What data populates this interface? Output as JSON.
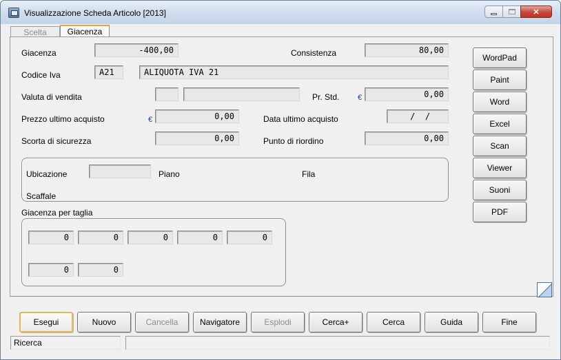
{
  "window": {
    "title": "Visualizzazione Scheda Articolo [2013]",
    "controls": {
      "minimize": "_",
      "maximize": "□",
      "close": "✕"
    }
  },
  "tabs": [
    {
      "label": "Scelta",
      "active": false
    },
    {
      "label": "Giacenza",
      "active": true
    }
  ],
  "form": {
    "giacenza": {
      "label": "Giacenza",
      "value": "-400,00"
    },
    "consistenza": {
      "label": "Consistenza",
      "value": "80,00"
    },
    "codice_iva": {
      "label": "Codice Iva",
      "code": "A21",
      "description": "ALIQUOTA IVA 21"
    },
    "valuta_vendita": {
      "label": "Valuta di vendita",
      "code": "",
      "description": ""
    },
    "prezzo_std": {
      "label": "Pr. Std.",
      "currency": "€",
      "value": "0,00"
    },
    "prezzo_ultimo_acquisto": {
      "label": "Prezzo ultimo acquisto",
      "currency": "€",
      "value": "0,00"
    },
    "data_ultimo_acquisto": {
      "label": "Data ultimo acquisto",
      "value": " /  /"
    },
    "scorta_sicurezza": {
      "label": "Scorta di sicurezza",
      "value": "0,00"
    },
    "punto_riordino": {
      "label": "Punto di riordino",
      "value": "0,00"
    },
    "ubicazione": {
      "label": "Ubicazione",
      "value": "",
      "piano_label": "Piano",
      "fila_label": "Fila",
      "scaffale_label": "Scaffale"
    },
    "taglie": {
      "label": "Giacenza per taglia",
      "values": [
        "0",
        "0",
        "0",
        "0",
        "0",
        "0",
        "0"
      ]
    }
  },
  "side_buttons": [
    "WordPad",
    "Paint",
    "Word",
    "Excel",
    "Scan",
    "Viewer",
    "Suoni",
    "PDF"
  ],
  "bottom_buttons": {
    "esegui": "Esegui",
    "nuovo": "Nuovo",
    "cancella": "Cancella",
    "navigatore": "Navigatore",
    "esplodi": "Esplodi",
    "cerca_plus": "Cerca+",
    "cerca": "Cerca",
    "guida": "Guida",
    "fine": "Fine"
  },
  "status_bar": {
    "left": "Ricerca",
    "right": ""
  },
  "colors": {
    "default_button_border": "#e8b54a",
    "active_tab_accent": "#e8a33c",
    "currency_symbol": "#1a3c9c"
  }
}
